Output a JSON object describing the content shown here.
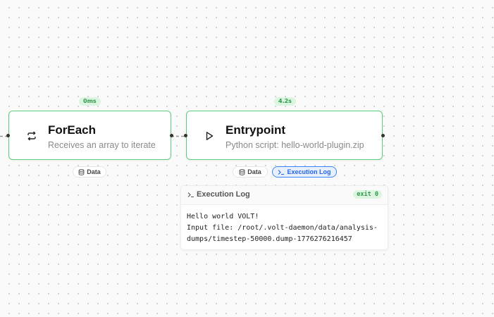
{
  "nodes": [
    {
      "id": "foreach",
      "title": "ForEach",
      "subtitle": "Receives an array to iterate",
      "icon": "repeat-icon",
      "duration": "0ms",
      "chips": [
        {
          "label": "Data",
          "icon": "database-icon",
          "active": false
        }
      ]
    },
    {
      "id": "entrypoint",
      "title": "Entrypoint",
      "subtitle": "Python script: hello-world-plugin.zip",
      "icon": "play-icon",
      "duration": "4.2s",
      "chips": [
        {
          "label": "Data",
          "icon": "database-icon",
          "active": false
        },
        {
          "label": "Execution Log",
          "icon": "terminal-icon",
          "active": true
        }
      ]
    }
  ],
  "execution_log": {
    "title": "Execution Log",
    "icon": "terminal-icon",
    "exit_status": "exit 0",
    "lines": [
      "Hello world VOLT!",
      "Input file: /root/.volt-daemon/data/analysis-",
      "dumps/timestep-50000.dump-1776276216457"
    ]
  },
  "colors": {
    "success_border": "#5fce7c",
    "success_badge_bg": "#dcf5e1",
    "success_badge_text": "#2f9a4c",
    "active_chip_border": "#3b82f6",
    "active_chip_text": "#2563eb"
  }
}
